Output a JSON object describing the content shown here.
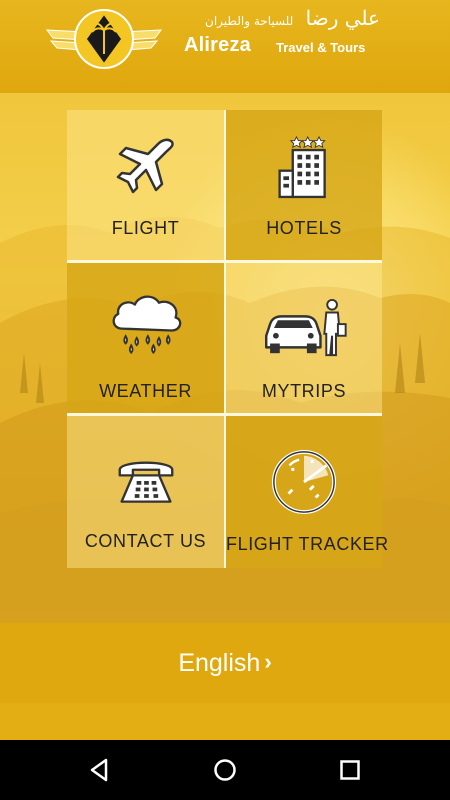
{
  "header": {
    "brand_arabic_main": "علي رضا",
    "brand_arabic_sub": "للسياحة والطيران",
    "brand_name": "Alireza",
    "brand_tagline": "Travel & Tours"
  },
  "menu": {
    "flight": "FLIGHT",
    "hotels": "HOTELS",
    "weather": "WEATHER",
    "mytrips": "MYTRIPS",
    "contact": "CONTACT US",
    "tracker": "FLIGHT TRACKER"
  },
  "language": {
    "label": "English"
  },
  "icons": {
    "flight": "airplane-icon",
    "hotels": "hotel-building-icon",
    "weather": "rain-cloud-icon",
    "mytrips": "car-traveler-icon",
    "contact": "telephone-icon",
    "tracker": "radar-icon",
    "chevron": "chevron-right-icon"
  },
  "colors": {
    "accent": "#e0a80f",
    "tile": "#d6a616",
    "text": "#222222"
  }
}
